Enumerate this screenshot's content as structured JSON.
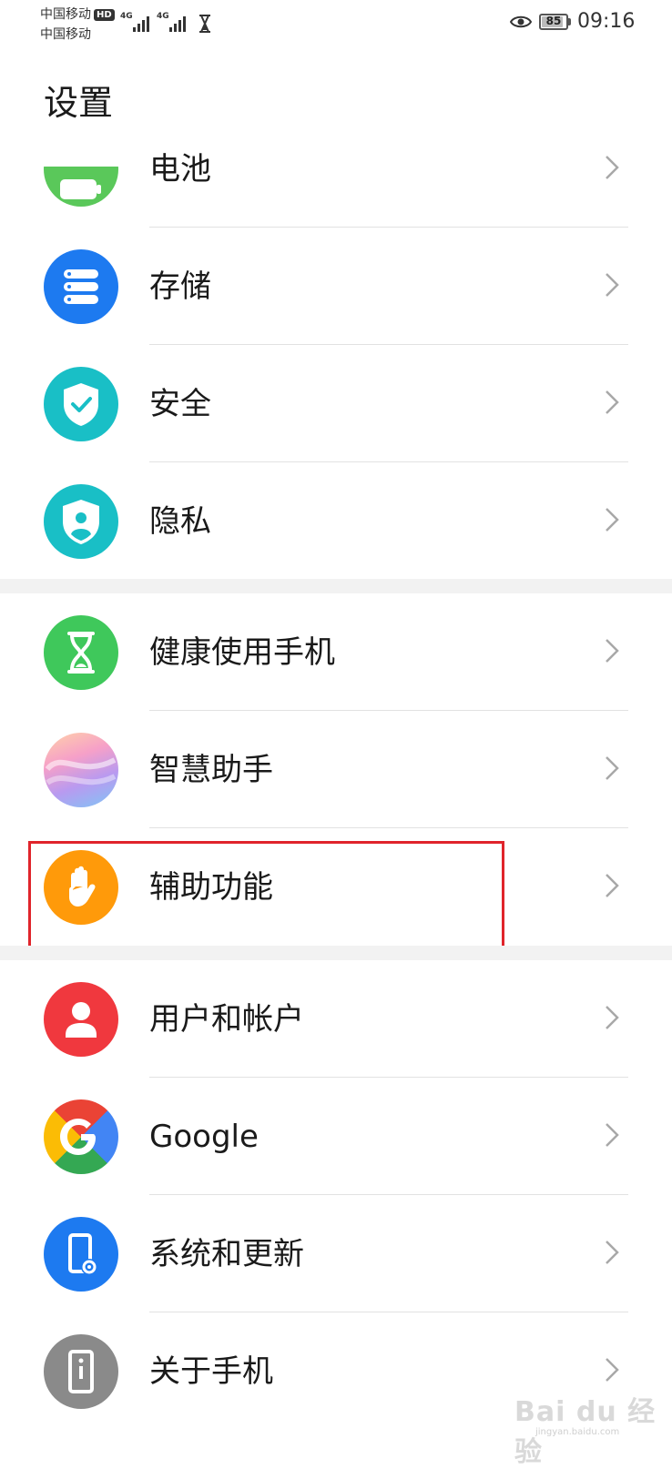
{
  "status_bar": {
    "carrier_1": "中国移动",
    "carrier_2": "中国移动",
    "hd_badge": "HD",
    "network_1": "4G",
    "network_2": "4G",
    "battery_level": "85",
    "time": "09:16"
  },
  "page": {
    "title": "设置"
  },
  "groups": [
    {
      "items": [
        {
          "label": "电池",
          "icon": "battery-icon",
          "color": "#5ac85a"
        },
        {
          "label": "存储",
          "icon": "storage-icon",
          "color": "#1d7af0"
        },
        {
          "label": "安全",
          "icon": "shield-check-icon",
          "color": "#19bfc6"
        },
        {
          "label": "隐私",
          "icon": "privacy-icon",
          "color": "#19bfc6"
        }
      ]
    },
    {
      "items": [
        {
          "label": "健康使用手机",
          "icon": "hourglass-icon",
          "color": "#3fc85b"
        },
        {
          "label": "智慧助手",
          "icon": "assistant-icon",
          "color": "#c9a7f0"
        },
        {
          "label": "辅助功能",
          "icon": "hand-icon",
          "color": "#ff9a0a"
        }
      ]
    },
    {
      "items": [
        {
          "label": "用户和帐户",
          "icon": "user-icon",
          "color": "#f0383e"
        },
        {
          "label": "Google",
          "icon": "google-icon",
          "color": "#4285f4"
        },
        {
          "label": "系统和更新",
          "icon": "system-update-icon",
          "color": "#1d7af0"
        },
        {
          "label": "关于手机",
          "icon": "phone-info-icon",
          "color": "#8a8a8a"
        }
      ]
    }
  ],
  "watermark": {
    "text": "Bai du 经验",
    "url_text": "jingyan.baidu.com"
  }
}
